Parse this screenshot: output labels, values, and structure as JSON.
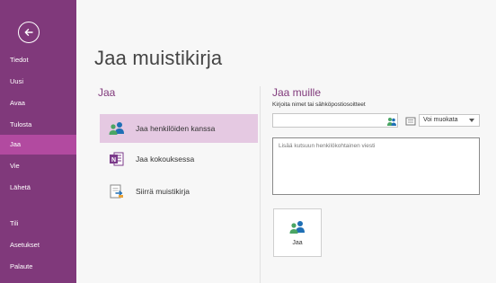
{
  "sidebar": {
    "items": [
      {
        "label": "Tiedot"
      },
      {
        "label": "Uusi"
      },
      {
        "label": "Avaa"
      },
      {
        "label": "Tulosta"
      },
      {
        "label": "Jaa"
      },
      {
        "label": "Vie"
      },
      {
        "label": "Lähetä"
      },
      {
        "label": "Tili"
      },
      {
        "label": "Asetukset"
      },
      {
        "label": "Palaute"
      }
    ]
  },
  "main": {
    "title": "Jaa muistikirja",
    "section_title": "Jaa",
    "options": [
      {
        "label": "Jaa henkilöiden kanssa",
        "icon": "people-icon"
      },
      {
        "label": "Jaa kokouksessa",
        "icon": "onenote-icon"
      },
      {
        "label": "Siirrä muistikirja",
        "icon": "move-notebook-icon"
      }
    ]
  },
  "share": {
    "title": "Jaa muille",
    "names_label": "Kirjoita nimet tai sähköpostiosoitteet",
    "names_value": "",
    "permission": "Voi muokata",
    "message_placeholder": "Lisää kutsuun henkilökohtainen viesti",
    "button_label": "Jaa"
  },
  "colors": {
    "sidebar": "#80397b",
    "sidebar_active": "#b24aa0",
    "accent": "#80397b",
    "selected_option": "#e5c9e2"
  }
}
